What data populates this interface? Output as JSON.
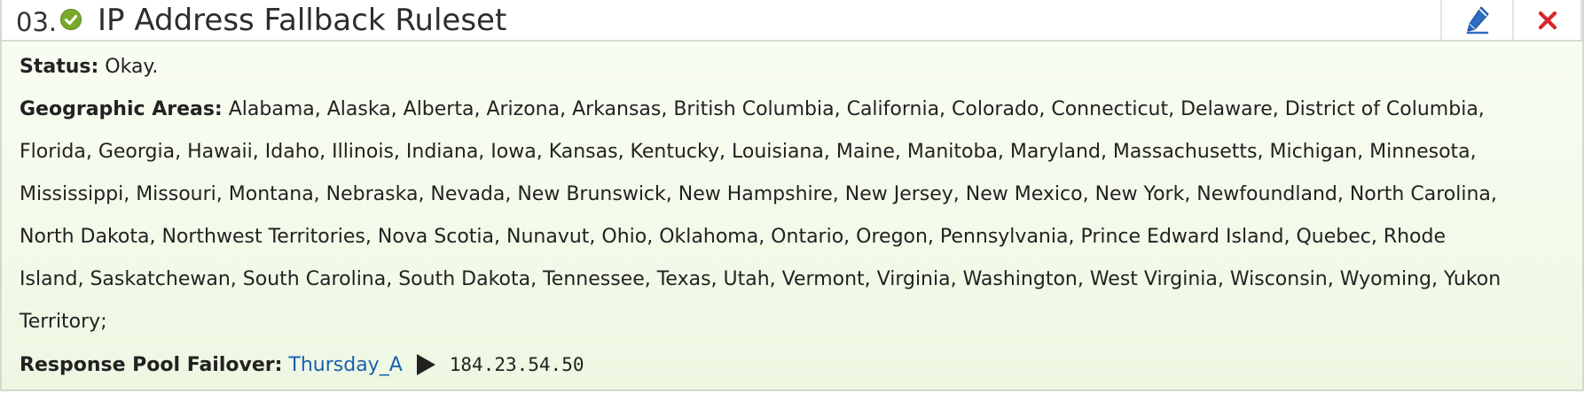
{
  "rule": {
    "number": "03.",
    "title": "IP Address Fallback Ruleset",
    "status_icon": "check-circle-icon",
    "status_color": "#79a92a"
  },
  "actions": {
    "edit_icon": "pencil-icon",
    "delete_icon": "close-icon",
    "edit_color": "#2d6bc4",
    "delete_color": "#d7262b"
  },
  "details": {
    "status_label": "Status:",
    "status_value": "Okay.",
    "areas_label": "Geographic Areas:",
    "areas_value": "Alabama, Alaska, Alberta, Arizona, Arkansas, British Columbia, California, Colorado, Connecticut, Delaware, District of Columbia, Florida, Georgia, Hawaii, Idaho, Illinois, Indiana, Iowa, Kansas, Kentucky, Louisiana, Maine, Manitoba, Maryland, Massachusetts, Michigan, Minnesota, Mississippi, Missouri, Montana, Nebraska, Nevada, New Brunswick, New Hampshire, New Jersey, New Mexico, New York, Newfoundland, North Carolina, North Dakota, Northwest Territories, Nova Scotia, Nunavut, Ohio, Oklahoma, Ontario, Oregon, Pennsylvania, Prince Edward Island, Quebec, Rhode Island, Saskatchewan, South Carolina, South Dakota, Tennessee, Texas, Utah, Vermont, Virginia, Washington, West Virginia, Wisconsin, Wyoming, Yukon Territory;",
    "pool_label": "Response Pool Failover:",
    "pool_name": "Thursday_A",
    "pool_icon": "play-icon",
    "pool_ip": "184.23.54.50"
  }
}
